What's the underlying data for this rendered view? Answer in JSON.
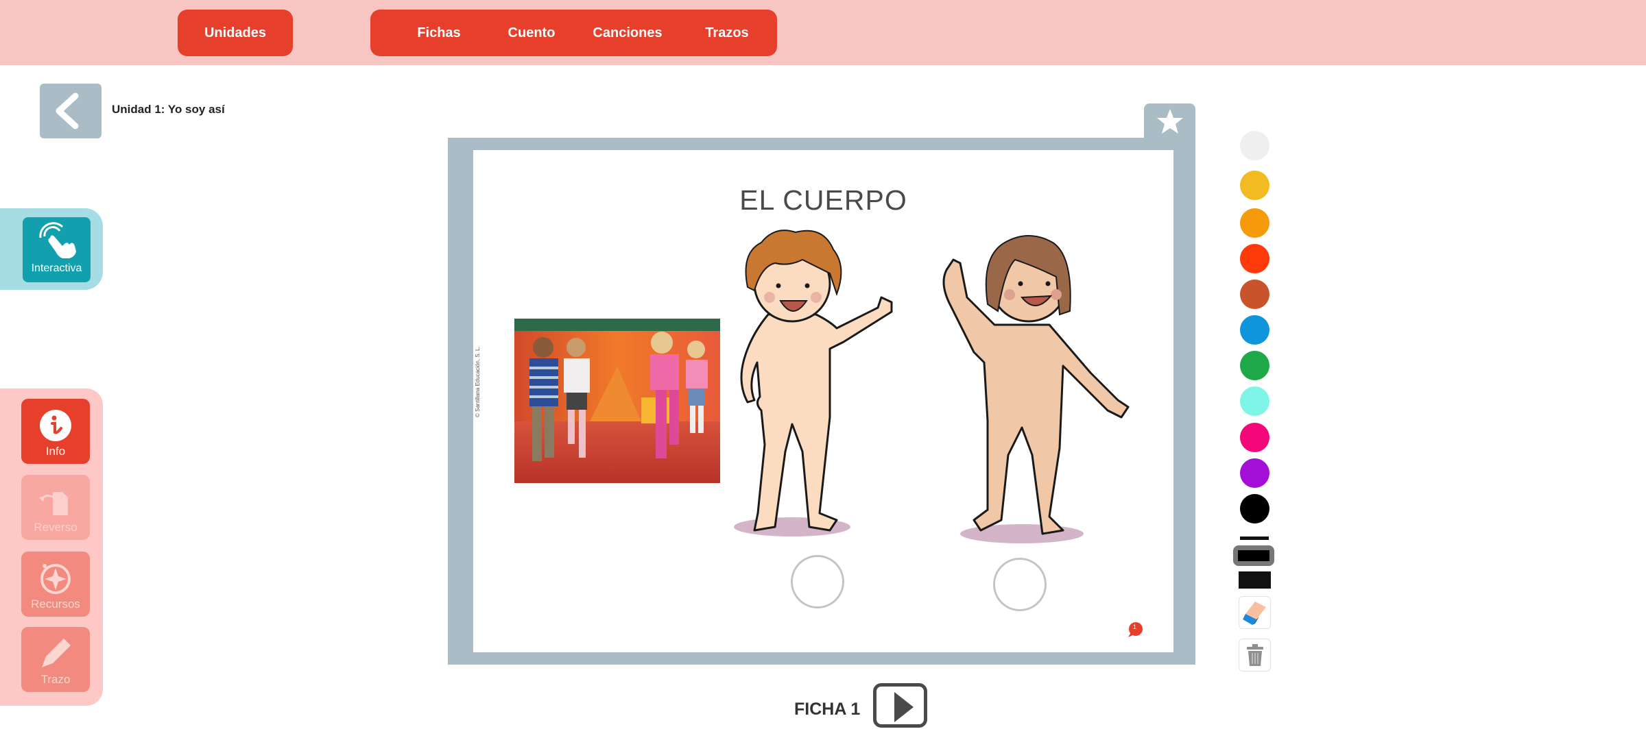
{
  "topbar": {
    "unidades_label": "Unidades",
    "nav": [
      {
        "label": "Fichas"
      },
      {
        "label": "Cuento"
      },
      {
        "label": "Canciones"
      },
      {
        "label": "Trazos"
      }
    ]
  },
  "header": {
    "back_icon": "chevron-left-icon",
    "unit_title": "Unidad 1: Yo soy así"
  },
  "left_panel": {
    "interactive": {
      "label": "Interactiva",
      "icon": "tap-hand-icon"
    },
    "tools": [
      {
        "label": "Info",
        "icon": "info-icon",
        "state": "active"
      },
      {
        "label": "Reverso",
        "icon": "page-flip-icon",
        "state": "disabled"
      },
      {
        "label": "Recursos",
        "icon": "compass-icon",
        "state": "enabled"
      },
      {
        "label": "Trazo",
        "icon": "pencil-icon",
        "state": "enabled"
      }
    ]
  },
  "worksheet": {
    "title": "EL CUERPO",
    "copyright": "© Santillana Educación, S. L.",
    "favorite_icon": "star-icon",
    "photo_alt": "Children dancing in a playroom",
    "figures": [
      "boy-illustration",
      "girl-illustration"
    ],
    "comment_count": "1",
    "answer_circles": 2
  },
  "footer": {
    "ficha_label": "FICHA 1",
    "next_icon": "play-next-icon"
  },
  "palette": {
    "colors": [
      "#efefef",
      "#f2bb22",
      "#f59a0a",
      "#ff3a0a",
      "#c9532a",
      "#0f95dc",
      "#1ea847",
      "#7ff5e9",
      "#f5077a",
      "#a30fd8",
      "#000000"
    ],
    "stroke_sizes": [
      "thin",
      "medium",
      "thick"
    ],
    "selected_stroke": "medium",
    "eraser_icon": "eraser-icon",
    "trash_icon": "trash-icon"
  },
  "colors": {
    "brand_red": "#e6402c",
    "topbar_bg": "#f7c5c2",
    "frame_gray": "#aabdc6",
    "interactive_teal": "#13a0ae"
  }
}
